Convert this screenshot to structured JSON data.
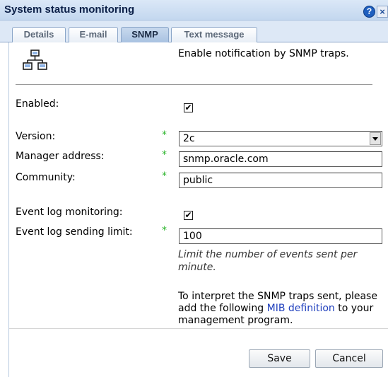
{
  "window": {
    "title": "System status monitoring",
    "help_icon": "help-icon",
    "close_icon": "close-icon"
  },
  "tabs": [
    {
      "label": "Details",
      "active": false
    },
    {
      "label": "E-mail",
      "active": false
    },
    {
      "label": "SNMP",
      "active": true
    },
    {
      "label": "Text message",
      "active": false
    }
  ],
  "header": {
    "icon": "network-icon",
    "text": "Enable notification by SNMP traps."
  },
  "form": {
    "enabled_label": "Enabled:",
    "enabled_checked": true,
    "version_label": "Version:",
    "version_value": "2c",
    "manager_label": "Manager address:",
    "manager_value": "snmp.oracle.com",
    "community_label": "Community:",
    "community_value": "public",
    "eventlog_label": "Event log monitoring:",
    "eventlog_checked": true,
    "limit_label": "Event log sending limit:",
    "limit_value": "100",
    "limit_hint": "Limit the number of events sent per minute.",
    "required_marker": "*",
    "checkmark": "✔"
  },
  "mib_note": {
    "before": "To interpret the SNMP traps sent, please add the following ",
    "link": "MIB definition",
    "after": " to your management program."
  },
  "buttons": {
    "save": "Save",
    "cancel": "Cancel"
  },
  "colors": {
    "required_marker": "#2db52d",
    "link": "#1f3fbd",
    "title_text": "#0b1f47"
  }
}
